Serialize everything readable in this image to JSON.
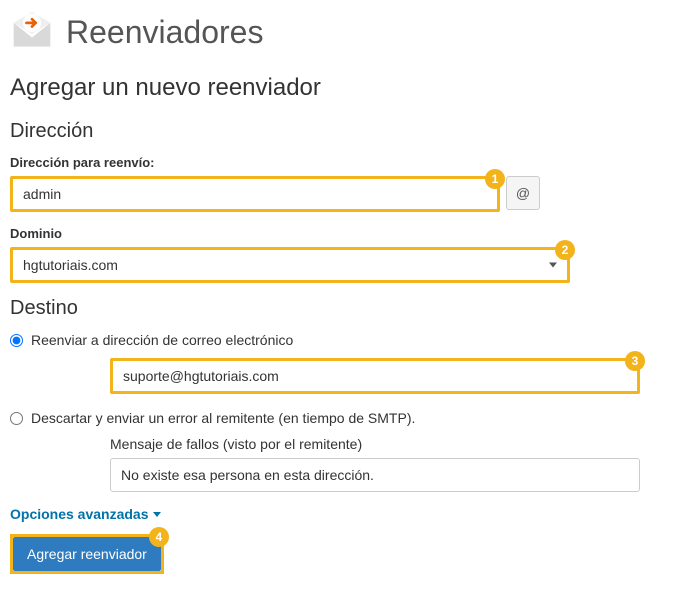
{
  "header": {
    "title": "Reenviadores"
  },
  "subtitle": "Agregar un nuevo reenviador",
  "direccion": {
    "heading": "Dirección",
    "address_label": "Dirección para reenvío:",
    "address_value": "admin",
    "at": "@",
    "domain_label": "Dominio",
    "domain_value": "hgtutoriais.com"
  },
  "destino": {
    "heading": "Destino",
    "forward_label": "Reenviar a dirección de correo electrónico",
    "forward_value": "suporte@hgtutoriais.com",
    "discard_label": "Descartar y enviar un error al remitente (en tiempo de SMTP).",
    "fail_msg_label": "Mensaje de fallos (visto por el remitente)",
    "fail_msg_value": "No existe esa persona en esta dirección."
  },
  "advanced_label": "Opciones avanzadas",
  "submit_label": "Agregar reenviador",
  "badges": {
    "b1": "1",
    "b2": "2",
    "b3": "3",
    "b4": "4"
  }
}
